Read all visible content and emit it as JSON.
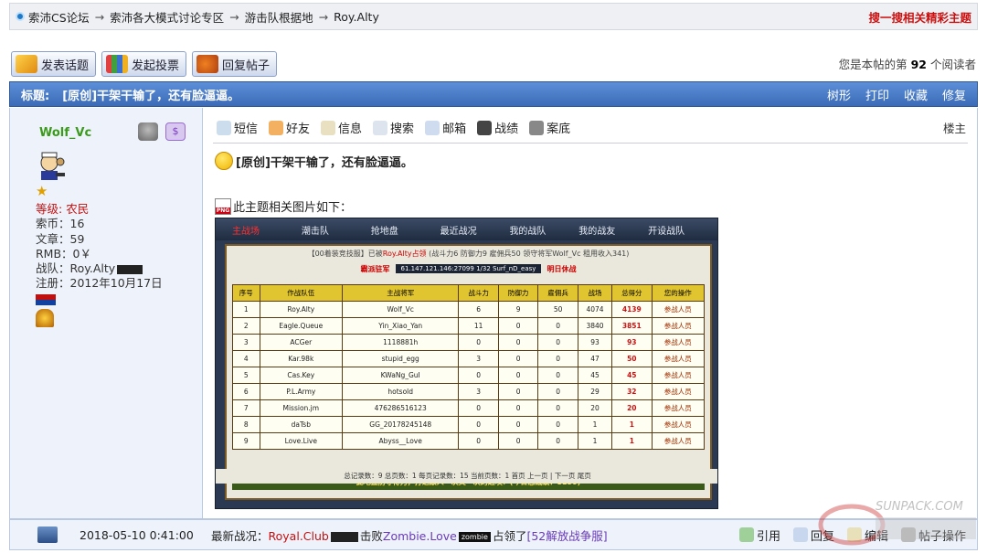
{
  "breadcrumb": {
    "items": [
      "索沛CS论坛",
      "索沛各大模式讨论专区",
      "游击队根据地",
      "Roy.Alty"
    ],
    "separator": "→",
    "right_link": "搜一搜相关精彩主题"
  },
  "post_buttons": {
    "new_topic": "发表话题",
    "new_poll": "发起投票",
    "reply": "回复帖子"
  },
  "readers": {
    "prefix": "您是本帖的第",
    "count": "92",
    "suffix": "个阅读者"
  },
  "title_bar": {
    "label": "标题:",
    "title": "[原创]干架干输了，还有脸逼逼。",
    "actions": [
      "树形",
      "打印",
      "收藏",
      "修复"
    ]
  },
  "user": {
    "name": "Wolf_Vc",
    "level_label": "等级:",
    "level": "农民",
    "coins": "索币：16",
    "posts": "文章：59",
    "rmb": "RMB：0￥",
    "team": "战队：Roy.Alty",
    "registered": "注册：2012年10月17日"
  },
  "post_tools": [
    "短信",
    "好友",
    "信息",
    "搜索",
    "邮箱",
    "战绩",
    "案底"
  ],
  "floor_label": "楼主",
  "post": {
    "title": "[原创]干架干输了，还有脸逼逼。",
    "image_caption": "此主题相关图片如下："
  },
  "game": {
    "nav": [
      "主战场",
      "潮击队",
      "抢地盘",
      "最近战况",
      "我的战队",
      "我的战友",
      "开设战队"
    ],
    "message_prefix": "【00着装竞技服】已被",
    "message_team": "Roy.Alty占领",
    "message_rest": "(战斗力6 防御力9 雇佣兵50 领守将军Wolf_Vc 租用收入341)",
    "server_label": "霸派驻军",
    "server_info": "61.147.121.146:27099  1/32  Surf_nD_easy",
    "server_note": "明日休战",
    "footer": "此地盘防守得力，打退敌人一次又一次的进攻！(今日总战绩：8150)",
    "pager": "总记录数：9 总页数：1 每页记录数：15 当前页数：1 首页 上一页 | 下一页 尾页"
  },
  "chart_data": {
    "type": "table",
    "columns": [
      "序号",
      "作战队伍",
      "主战将军",
      "战斗力",
      "防御力",
      "雇佣兵",
      "战场",
      "总得分",
      "您的操作"
    ],
    "rows": [
      [
        "1",
        "Roy.Alty",
        "Wolf_Vc",
        "6",
        "9",
        "50",
        "4074",
        "4139",
        "参战人员"
      ],
      [
        "2",
        "Eagle.Queue",
        "Yin_Xiao_Yan",
        "11",
        "0",
        "0",
        "3840",
        "3851",
        "参战人员"
      ],
      [
        "3",
        "ACGer",
        "1118881h",
        "0",
        "0",
        "0",
        "93",
        "93",
        "参战人员"
      ],
      [
        "4",
        "Kar.98k",
        "stupid_egg",
        "3",
        "0",
        "0",
        "47",
        "50",
        "参战人员"
      ],
      [
        "5",
        "Cas.Key",
        "KWaNg_GuI",
        "0",
        "0",
        "0",
        "45",
        "45",
        "参战人员"
      ],
      [
        "6",
        "P.L.Army",
        "hotsold",
        "3",
        "0",
        "0",
        "29",
        "32",
        "参战人员"
      ],
      [
        "7",
        "Mission.jm",
        "476286516123",
        "0",
        "0",
        "0",
        "20",
        "20",
        "参战人员"
      ],
      [
        "8",
        "daTsb",
        "GG_20178245148",
        "0",
        "0",
        "0",
        "1",
        "1",
        "参战人员"
      ],
      [
        "9",
        "Love.Live",
        "Abyss__Love",
        "0",
        "0",
        "0",
        "1",
        "1",
        "参战人员"
      ]
    ]
  },
  "footer": {
    "date": "2018-05-10 0:41:00",
    "latest_label": "最新战况：",
    "team1": "Royal.Club",
    "mid": "击败",
    "team2": "Zombie.Love",
    "tag": "zombie",
    "rest": "占领了",
    "link": "[52解放战争服]",
    "actions": [
      "引用",
      "回复",
      "编辑",
      "帖子操作"
    ]
  },
  "colors": {
    "accent": "#3b6bb6",
    "title_red": "#cc1010",
    "green_name": "#3a9a1a"
  }
}
